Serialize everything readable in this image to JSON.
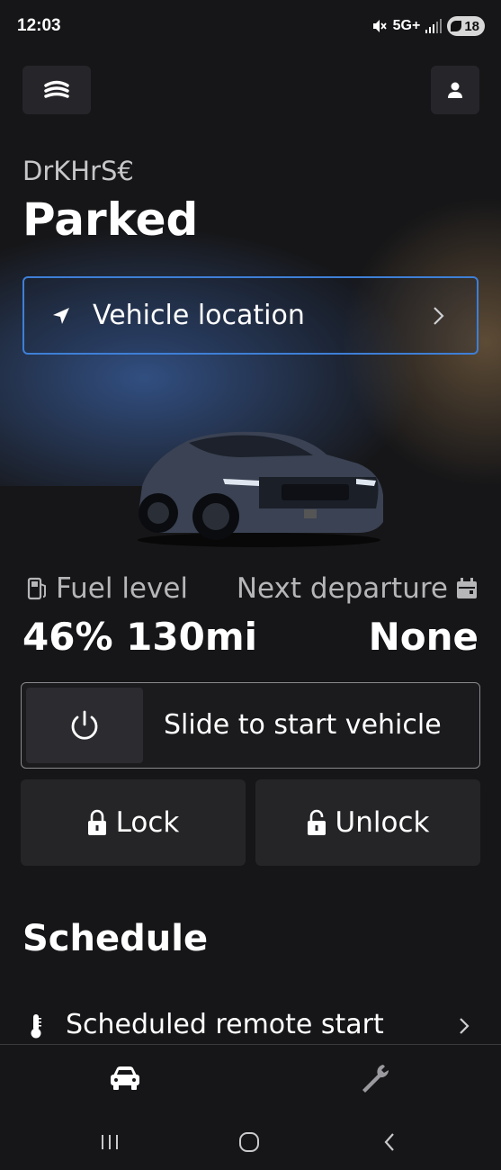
{
  "status_bar": {
    "time": "12:03",
    "network": "5G+",
    "battery": "18",
    "icons": [
      "mute-icon",
      "signal-icon",
      "battery-saver-icon"
    ]
  },
  "header": {
    "menu_icon": "layers-menu-icon",
    "profile_icon": "person-icon"
  },
  "vehicle": {
    "name": "DrKHrS€",
    "status": "Parked"
  },
  "location": {
    "label": "Vehicle location",
    "icon": "navigation-arrow-icon"
  },
  "stats": {
    "fuel_label": "Fuel level",
    "fuel_value": "46% 130mi",
    "departure_label": "Next departure",
    "departure_value": "None"
  },
  "slider": {
    "label": "Slide to start vehicle",
    "icon": "power-icon"
  },
  "actions": {
    "lock_label": "Lock",
    "unlock_label": "Unlock"
  },
  "schedule": {
    "title": "Schedule",
    "items": [
      {
        "label": "Scheduled remote start",
        "icon": "thermometer-icon"
      }
    ]
  },
  "bottom_nav": {
    "items": [
      "car-icon",
      "wrench-icon"
    ]
  },
  "colors": {
    "background": "#161618",
    "accent_border": "#3e7fd6",
    "button_bg": "#252528",
    "secondary_text": "#b6b6b8"
  }
}
